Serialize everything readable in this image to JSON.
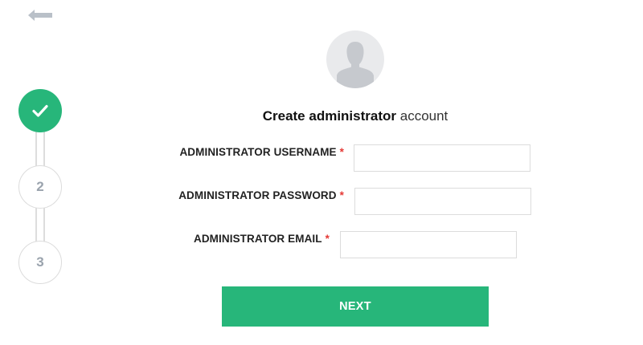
{
  "nav": {
    "back_icon": "arrow-left-icon"
  },
  "stepper": {
    "steps": [
      {
        "label": "",
        "status": "complete",
        "icon": "checkmark-icon"
      },
      {
        "label": "2",
        "status": "pending"
      },
      {
        "label": "3",
        "status": "pending"
      }
    ]
  },
  "avatar": {
    "icon": "user-silhouette-icon"
  },
  "heading": {
    "strong": "Create administrator",
    "light": "account"
  },
  "form": {
    "username": {
      "label": "ADMINISTRATOR USERNAME",
      "required_mark": "*",
      "value": "",
      "placeholder": ""
    },
    "password": {
      "label": "ADMINISTRATOR PASSWORD",
      "required_mark": "*",
      "value": "",
      "placeholder": ""
    },
    "email": {
      "label": "ADMINISTRATOR EMAIL",
      "required_mark": "*",
      "value": "",
      "placeholder": ""
    }
  },
  "actions": {
    "next_label": "NEXT"
  },
  "colors": {
    "accent": "#27b67a",
    "required": "#e53935",
    "border": "#dcdcdc"
  }
}
